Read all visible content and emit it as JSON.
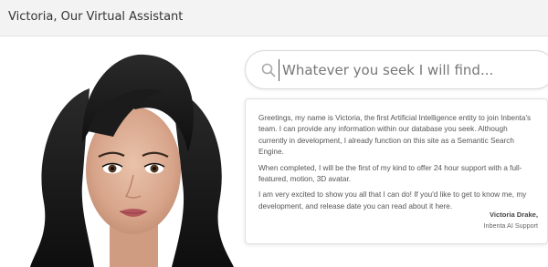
{
  "header": {
    "title": "Victoria, Our Virtual Assistant"
  },
  "search": {
    "placeholder": "Whatever you seek I will find..."
  },
  "bubble": {
    "paragraphs": [
      "Greetings, my name is Victoria, the first Artificial Intelligence entity to join Inbenta's team. I can provide any information within our database you seek. Although currently in development, I already function on this site as a Semantic Search Engine.",
      "When completed, I will be the first of my kind to offer 24 hour support with a full-featured, motion, 3D avatar.",
      "I am very excited to show you all that I can do! If you'd like to get to know me, my development, and release date you can read about it here."
    ],
    "signature_name": "Victoria Drake,",
    "signature_role": "Inbenta AI Support"
  },
  "icons": {
    "search": "search-icon",
    "avatar": "virtual-assistant-avatar"
  },
  "colors": {
    "header_bg": "#f3f3f3",
    "text": "#555555",
    "border": "#e0e0e0"
  }
}
